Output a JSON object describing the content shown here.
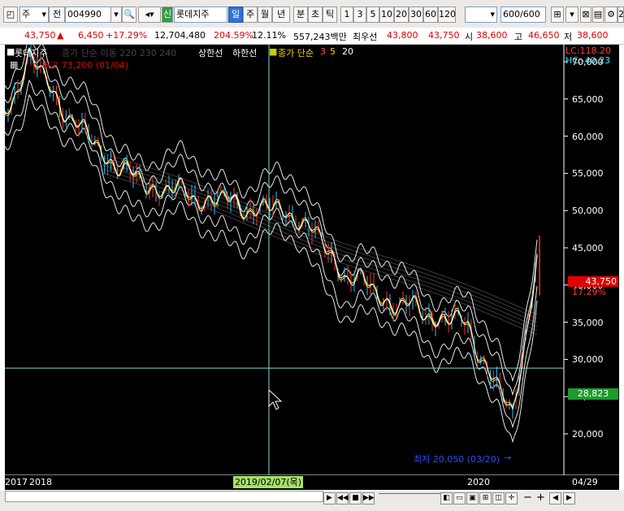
{
  "toolbar": {
    "type_label": "주",
    "full_label": "전",
    "code": "004990",
    "badge": "신",
    "stock_name": "롯데지주",
    "periods": [
      "일",
      "주",
      "월",
      "년",
      "분",
      "초",
      "틱"
    ],
    "active_period": "일",
    "intervals": [
      "1",
      "3",
      "5",
      "10",
      "20",
      "30",
      "60",
      "120"
    ],
    "count": "600",
    "count_total": "/600",
    "edge_label": "20"
  },
  "quote": {
    "price": "43,750",
    "change": "6,450",
    "change_pct": "+17.29%",
    "volume": "12,704,480",
    "volume_ratio": "204.59%",
    "turnover": "12.11%",
    "amount": "557,243백만",
    "best_ask_label": "최우선",
    "best_ask": "43,800",
    "best_bid": "43,750",
    "open_label": "시",
    "open": "38,600",
    "high_label": "고",
    "high": "46,650",
    "low_label": "저",
    "low": "38,600"
  },
  "chart": {
    "legend": {
      "name": "롯데지주",
      "item2": "종가 단순 이동 220 230 240",
      "upper": "상한선",
      "lower": "하한선",
      "ma_label": "종가 단순",
      "ma3": "3",
      "ma5": "5",
      "ma20": "20"
    },
    "lc": "LC:118.20",
    "hc": "HC:-40.23",
    "high_note": "최고 73,200 (01/04)",
    "low_note": "최저 20,050 (03/20)",
    "last_price": "43,750",
    "last_pct": "17.29%",
    "crosshair_price": "28,823",
    "crosshair_date": "2019/02/07(목)",
    "y_ticks": [
      "70,000",
      "65,000",
      "60,000",
      "55,000",
      "50,000",
      "45,000",
      "40,000",
      "35,000",
      "30,000",
      "25,000",
      "20,000"
    ],
    "x_labels": [
      "2017",
      "2018",
      "2020"
    ],
    "end_date": "04/29",
    "colors": {
      "up": "#ff3030",
      "down": "#27c4ff",
      "label_red": "#e00000",
      "crosshair": "#7fd7d7",
      "green_box": "#1c9c2a"
    }
  },
  "chart_data": {
    "type": "line",
    "title": "롯데지주",
    "series": [
      {
        "name": "종가",
        "x": [
          "2017-10",
          "2018-01",
          "2018-04",
          "2018-07",
          "2018-10",
          "2019-01",
          "2019-04",
          "2019-07",
          "2019-10",
          "2020-01",
          "2020-03",
          "2020-04"
        ],
        "values": [
          63000,
          70500,
          60500,
          54000,
          52000,
          50500,
          49500,
          41500,
          37500,
          34500,
          22000,
          43750
        ]
      }
    ],
    "ylim": [
      18000,
      75000
    ]
  },
  "status": {
    "end_date": "04/29"
  }
}
